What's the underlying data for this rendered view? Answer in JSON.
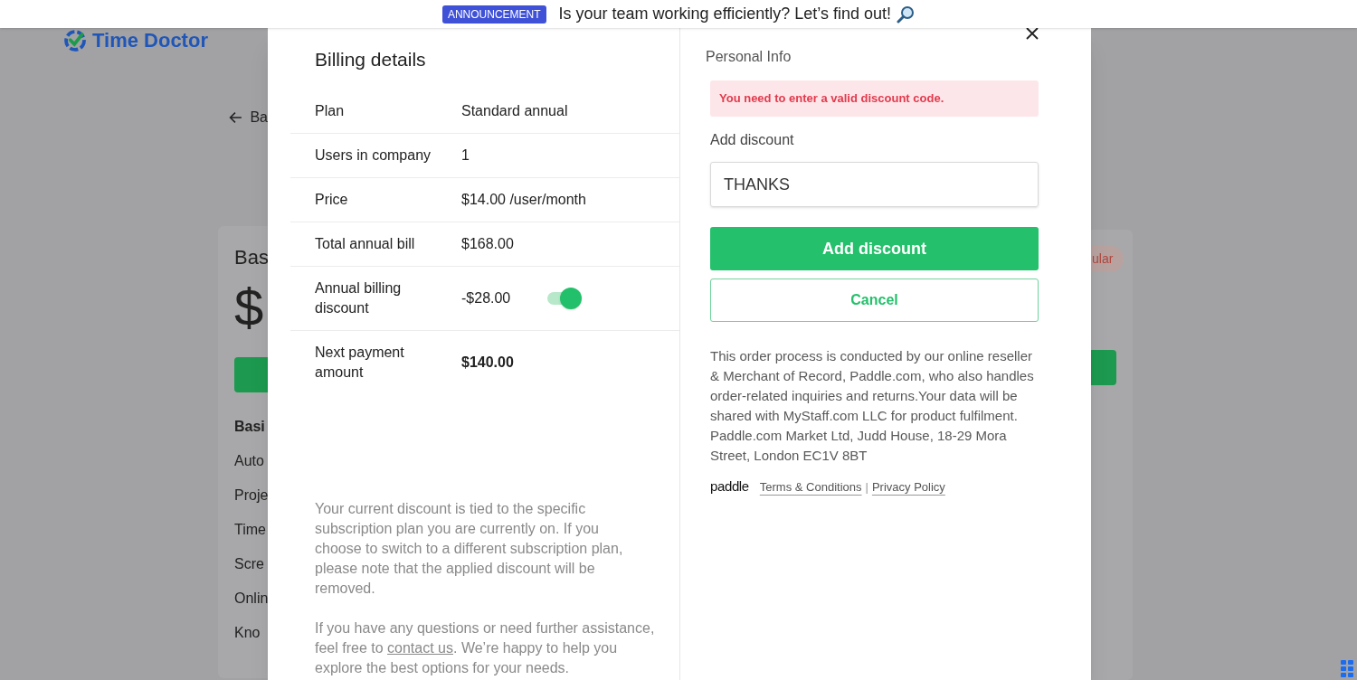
{
  "announcement": {
    "badge": "ANNOUNCEMENT",
    "text": "Is your team working efficiently? Let’s find out!"
  },
  "background": {
    "logo": "Time Doctor",
    "back_link": "Ba",
    "card": {
      "title": "Bas",
      "price": "$",
      "badge": "ular",
      "features_heading": "Basi",
      "features": [
        "Auto",
        "Proje",
        "Time",
        "Scre",
        "Onlin",
        "Kno"
      ]
    }
  },
  "billing": {
    "title": "Billing details",
    "rows": [
      {
        "kind": "text",
        "label": "Plan",
        "value": "Standard annual"
      },
      {
        "kind": "text",
        "label": "Users in company",
        "value": "1"
      },
      {
        "kind": "text",
        "label": "Price",
        "value": "$14.00 /user/month"
      },
      {
        "kind": "text",
        "label": "Total annual bill",
        "value": "$168.00"
      },
      {
        "kind": "toggle",
        "label": "Annual billing discount",
        "value": "-$28.00",
        "on": true
      },
      {
        "kind": "total",
        "label": "Next payment amount",
        "value": "$140.00"
      }
    ],
    "note": "Your current discount is tied to the specific subscription plan you are currently on. If you choose to switch to a different subscription plan, please note that the applied discount will be removed.",
    "help": {
      "before": "If you have any questions or need further assistance, feel free to ",
      "link": "contact us",
      "after": ". We’re happy to help you explore the best options for your needs."
    }
  },
  "checkout": {
    "section_title": "Personal Info",
    "error": "You need to enter a valid discount code.",
    "field": {
      "label": "Add discount",
      "value": "THANKS"
    },
    "buttons": [
      {
        "kind": "primary",
        "label": "Add discount"
      },
      {
        "kind": "secondary",
        "label": "Cancel"
      }
    ],
    "disclaimer": "This order process is conducted by our online reseller & Merchant of Record, Paddle.com, who also handles order-related inquiries and returns.Your data will be shared with MyStaff.com LLC for product fulfilment. Paddle.com Market Ltd, Judd House, 18-29 Mora Street, London EC1V 8BT",
    "footer": {
      "brand": "paddle",
      "links": [
        "Terms & Conditions",
        "Privacy Policy"
      ],
      "separator": "|"
    }
  }
}
